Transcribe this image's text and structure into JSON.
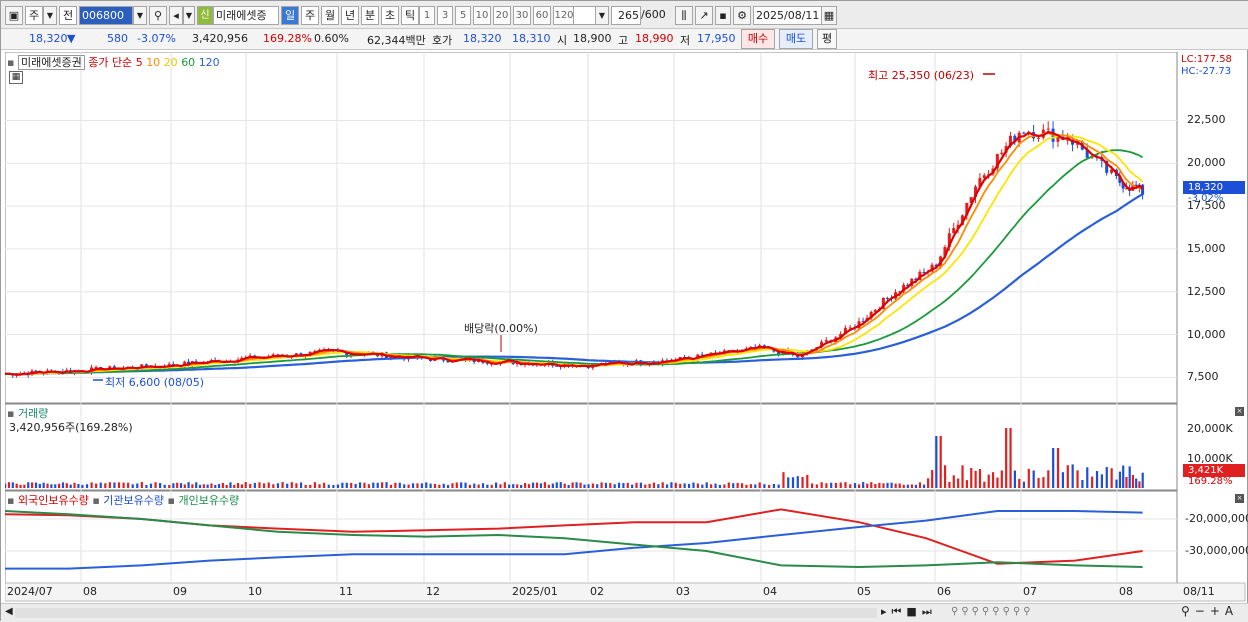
{
  "toolbar": {
    "period_main": "주",
    "code_prefix": "전",
    "stock_code": "006800",
    "credit_badge": "신",
    "stock_name": "미래에셋증",
    "periods": [
      "일",
      "주",
      "월",
      "년",
      "분",
      "초",
      "틱"
    ],
    "numbers": [
      "1",
      "3",
      "5",
      "10",
      "20",
      "30",
      "60",
      "120"
    ],
    "count_label": "265",
    "count_total": "/600",
    "date_value": "2025/08/11"
  },
  "quote": {
    "price": "18,320",
    "direction": "▼",
    "change": "580",
    "change_pct": "-3.07%",
    "volume": "3,420,956",
    "volume_ratio": "169.28%",
    "turnover": "0.60%",
    "amount": "62,344백만",
    "ask_label": "호가",
    "ask": "18,320",
    "bid": "18,310",
    "open_label": "시",
    "open": "18,900",
    "high_label": "고",
    "high": "18,990",
    "low_label": "저",
    "low": "17,950",
    "buy_label": "매수",
    "sell_label": "매도",
    "eval_label": "평"
  },
  "price_panel": {
    "name": "미래에셋증권",
    "ma_label": "종가 단순",
    "ma_periods": [
      "5",
      "10",
      "20",
      "60",
      "120"
    ],
    "lc": "LC:177.58",
    "hc": "HC:-27.73",
    "high_annotation": "최고 25,350 (06/23)",
    "low_annotation": "최저 6,600 (08/05)",
    "dividend_annotation": "배당락(0.00%)",
    "current_price": "18,320",
    "current_pct": "-3.02%",
    "y_ticks": [
      "22,500",
      "20,000",
      "17,500",
      "15,000",
      "12,500",
      "10,000",
      "7,500"
    ]
  },
  "volume_panel": {
    "title": "거래량",
    "value": "3,420,956주(169.28%)",
    "y_ticks": [
      "20,000K",
      "10,000K"
    ],
    "current": "3,421K",
    "current_pct": "169.28%"
  },
  "holding_panel": {
    "series": [
      "외국인보유수량",
      "기관보유수량",
      "개인보유수량"
    ],
    "y_ticks": [
      "-20,000,000",
      "-30,000,000"
    ]
  },
  "x_axis": [
    "2024/07",
    "08",
    "09",
    "10",
    "11",
    "12",
    "2025/01",
    "02",
    "03",
    "04",
    "05",
    "06",
    "07",
    "08",
    "08/11"
  ],
  "chart_data": {
    "type": "candlestick",
    "ma_colors": {
      "5": "#e00000",
      "10": "#ff8c00",
      "20": "#ffe400",
      "60": "#1a9a3c",
      "120": "#2b5fd9"
    },
    "price_ylim": [
      6000,
      26500
    ],
    "price_series": {
      "x_months": [
        0,
        1,
        2,
        3,
        4,
        5,
        6,
        7,
        8,
        9,
        9.4,
        10,
        10.5,
        11,
        11.5,
        12,
        12.5,
        13,
        13.4
      ],
      "close": [
        7700,
        7900,
        8200,
        8600,
        9000,
        8600,
        8400,
        8200,
        8500,
        9200,
        8700,
        10500,
        12500,
        14000,
        19000,
        22000,
        21500,
        19000,
        18320
      ]
    },
    "volume_note": "relative bars",
    "holdings": {
      "foreign": [
        -18500000,
        -18800000,
        -20000000,
        -22000000,
        -23000000,
        -24000000,
        -23500000,
        -23000000,
        -22000000,
        -21000000,
        -21000000,
        -17000000,
        -21000000,
        -26000000,
        -34000000,
        -33000000,
        -30000000
      ],
      "institution": [
        -35500000,
        -35500000,
        -34500000,
        -33000000,
        -32000000,
        -31000000,
        -31000000,
        -31000000,
        -31000000,
        -29000000,
        -27500000,
        -25000000,
        -22500000,
        -20500000,
        -17500000,
        -17500000,
        -18000000
      ],
      "individual": [
        -17500000,
        -18500000,
        -20000000,
        -22000000,
        -24000000,
        -25000000,
        -25500000,
        -25000000,
        -26000000,
        -28000000,
        -30000000,
        -34500000,
        -35000000,
        -34500000,
        -33500000,
        -34500000,
        -35000000
      ]
    }
  }
}
